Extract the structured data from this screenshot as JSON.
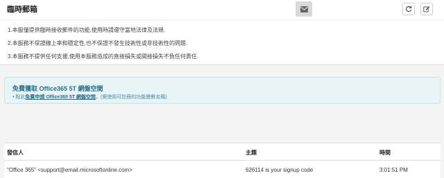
{
  "header": {
    "title": "臨時郵箱",
    "address_value": "",
    "envelope_icon": "envelope-icon",
    "refresh_icon": "refresh-icon",
    "edit_icon": "edit-icon"
  },
  "notice": {
    "lines": [
      "1.本服僅提供臨時接收郵件的功能,使用時請遵守當地法律及法規.",
      "2.本服務不保證線上率和穩定性,也不保證不發生技術性或非技術性的問題.",
      "3.本服務不提供任何支援,使用本服務造成的直接損失或間接損失不負任何責任."
    ]
  },
  "promo": {
    "title": "免費獲取 Office365 5T 網盤空間",
    "prefix": "• 點此",
    "link_text": "免費申請 Office365 5T 網盤空間",
    "suffix": "。(需使用可註冊的功能變數名稱)"
  },
  "table": {
    "columns": [
      "發信人",
      "主題",
      "時間"
    ],
    "rows": [
      {
        "sender": "\"Office 365\" <support@email.microsoftonline.com>",
        "subject": "626114 is your signup code",
        "time": "3:01:51 PM"
      }
    ]
  }
}
